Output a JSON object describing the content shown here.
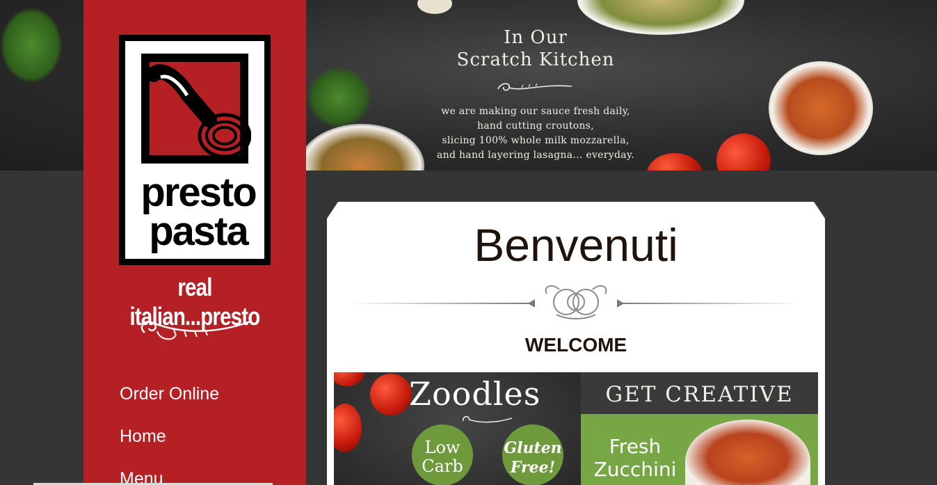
{
  "hero": {
    "title_line1": "In Our",
    "title_line2": "Scratch Kitchen",
    "body_lines": [
      "we are making our sauce fresh daily,",
      "hand cutting croutons,",
      "slicing 100% whole milk mozzarella,",
      "and hand layering lasagna... everyday."
    ]
  },
  "logo": {
    "word1": "presto",
    "word2": "pasta",
    "tagline": "real italian...presto"
  },
  "nav": {
    "items": [
      {
        "label": "Order Online"
      },
      {
        "label": "Home"
      },
      {
        "label": "Menu"
      }
    ]
  },
  "content": {
    "title": "Benvenuti",
    "subtitle": "WELCOME"
  },
  "promo": {
    "headline": "Zoodles",
    "badge_low_line1": "Low",
    "badge_low_line2": "Carb",
    "badge_gf_line1": "Gluten",
    "badge_gf_line2": "Free!",
    "right_headline": "GET CREATIVE",
    "fresh_line1": "Fresh",
    "fresh_line2": "Zucchini"
  },
  "colors": {
    "brand_red": "#b52024",
    "page_bg": "#353535",
    "promo_green": "#77a644",
    "heading_text": "#1f140c"
  }
}
